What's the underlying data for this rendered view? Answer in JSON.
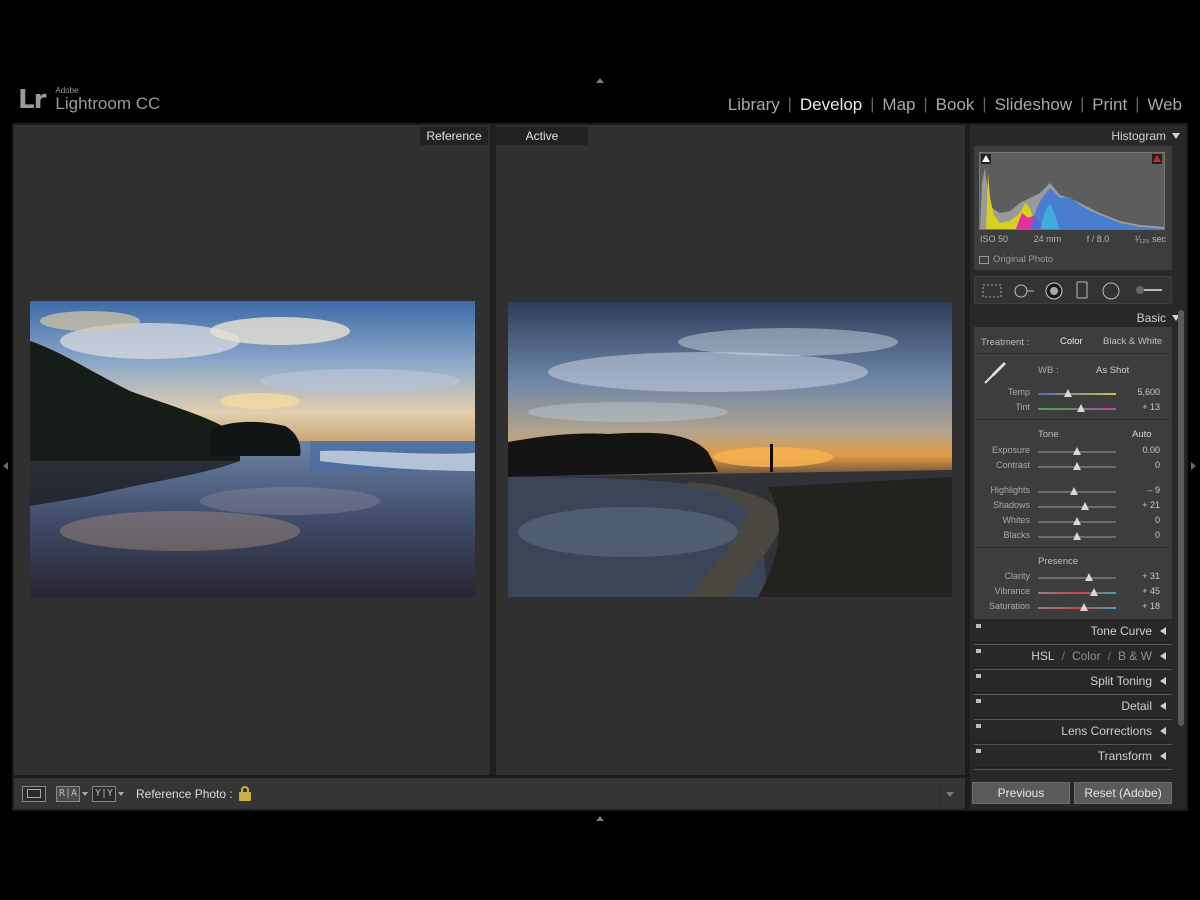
{
  "app": {
    "vendor": "Adobe",
    "name": "Lightroom CC",
    "mark": "Lr"
  },
  "modules": [
    "Library",
    "Develop",
    "Map",
    "Book",
    "Slideshow",
    "Print",
    "Web"
  ],
  "active_module": "Develop",
  "compare": {
    "reference_label": "Reference",
    "active_label": "Active"
  },
  "toolbar": {
    "ra_label": "R|A",
    "yy_label": "Y|Y",
    "reference_photo_label": "Reference Photo :"
  },
  "histogram": {
    "title": "Histogram",
    "iso": "ISO 50",
    "focal": "24 mm",
    "aperture": "f / 8.0",
    "shutter": "¹⁄₁₂₅ sec",
    "original_photo": "Original Photo"
  },
  "basic": {
    "title": "Basic",
    "treatment_label": "Treatment :",
    "treatment_color": "Color",
    "treatment_bw": "Black & White",
    "wb_label": "WB :",
    "wb_value": "As Shot",
    "tone_title": "Tone",
    "auto_label": "Auto",
    "presence_title": "Presence",
    "sliders": [
      {
        "label": "Temp",
        "value": "5,600",
        "pos": 0.38
      },
      {
        "label": "Tint",
        "value": "+ 13",
        "pos": 0.55
      },
      {
        "label": "Exposure",
        "value": "0.00",
        "pos": 0.5
      },
      {
        "label": "Contrast",
        "value": "0",
        "pos": 0.5
      },
      {
        "label": "Highlights",
        "value": "– 9",
        "pos": 0.46
      },
      {
        "label": "Shadows",
        "value": "+ 21",
        "pos": 0.6
      },
      {
        "label": "Whites",
        "value": "0",
        "pos": 0.5
      },
      {
        "label": "Blacks",
        "value": "0",
        "pos": 0.5
      },
      {
        "label": "Clarity",
        "value": "+ 31",
        "pos": 0.65
      },
      {
        "label": "Vibrance",
        "value": "+ 45",
        "pos": 0.72
      },
      {
        "label": "Saturation",
        "value": "+ 18",
        "pos": 0.59
      }
    ]
  },
  "panels": {
    "tone_curve": "Tone Curve",
    "hsl": "HSL",
    "color": "Color",
    "bw": "B & W",
    "split_toning": "Split Toning",
    "detail": "Detail",
    "lens_corrections": "Lens Corrections",
    "transform": "Transform"
  },
  "buttons": {
    "previous": "Previous",
    "reset": "Reset (Adobe)"
  },
  "colors": {
    "panel_bg": "#3d3d3d",
    "view_bg": "#303030",
    "lock": "#c8b040",
    "clip_warning": "#e02020"
  }
}
